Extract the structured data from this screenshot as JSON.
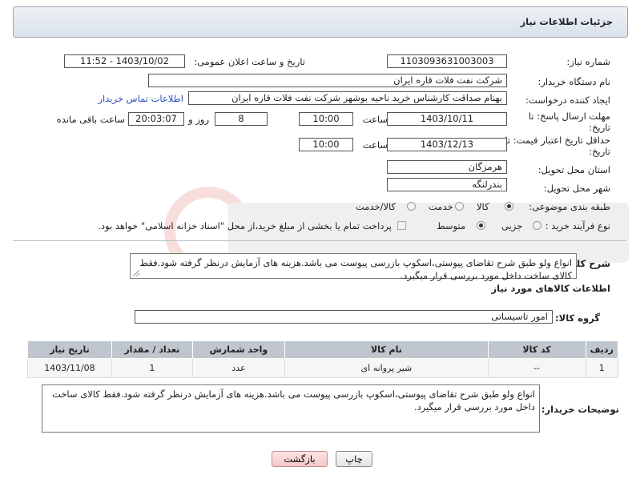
{
  "header": {
    "title": "جزئیات اطلاعات نیاز"
  },
  "form": {
    "need_number_label": "شماره نیاز:",
    "need_number": "1103093631003003",
    "announce_label": "تاریخ و ساعت اعلان عمومی:",
    "announce_value": "1403/10/02 - 11:52",
    "buyer_org_label": "نام دستگاه خریدار:",
    "buyer_org": "شرکت نفت فلات قاره ایران",
    "creator_label": "ایجاد کننده درخواست:",
    "creator": "بهنام  صداقت کارشناس خرید ناحیه بوشهر شرکت نفت فلات قاره ایران",
    "contact_link": "اطلاعات تماس خریدار",
    "reply_deadline_label": "مهلت ارسال پاسخ: تا",
    "reply_deadline_label2": "تاریخ:",
    "reply_date": "1403/10/11",
    "time_label": "ساعت",
    "reply_time": "10:00",
    "days_value": "8",
    "days_label": "روز و",
    "remaining_time": "20:03:07",
    "remaining_label": "ساعت باقی مانده",
    "price_validity_label": "حداقل تاریخ اعتبار قیمت: تا",
    "price_validity_label2": "تاریخ:",
    "price_date": "1403/12/13",
    "price_time": "10:00",
    "province_label": "استان محل تحویل:",
    "province": "هرمزگان",
    "city_label": "شهر محل تحویل:",
    "city": "بندرلنگه",
    "category_label": "طبقه بندی موضوعی:",
    "category_options": [
      "کالا",
      "خدمت",
      "کالا/خدمت"
    ],
    "process_label": "نوع فرآیند خرید :",
    "process_options": [
      "جزیی",
      "متوسط"
    ],
    "payment_text": "پرداخت تمام یا بخشی از مبلغ خرید،از محل \"اسناد خزانه اسلامی\" خواهد بود."
  },
  "description": {
    "label": "شرح کلی نیاز:",
    "text": "انواع ولو طبق شرح تقاضای پیوستی،اسکوپ بازرسی پیوست می باشد.هزینه های آزمایش درنظر گرفته شود.فقط کالای ساخت داخل مورد بررسی قرار میگیرد."
  },
  "goods": {
    "section_title": "اطلاعات کالاهای مورد نیاز",
    "group_label": "گروه کالا:",
    "group_value": "امور تاسیساتی",
    "columns": [
      "ردیف",
      "کد کالا",
      "نام کالا",
      "واحد شمارش",
      "تعداد / مقدار",
      "تاریخ نیاز"
    ],
    "rows": [
      [
        "1",
        "--",
        "شیر پروانه ای",
        "عدد",
        "1",
        "1403/11/08"
      ]
    ]
  },
  "buyer_notes": {
    "label": "توضیحات خریدار:",
    "text": "انواع ولو طبق شرح تقاضای پیوستی،اسکوپ بازرسی پیوست می باشد.هزینه های آزمایش درنظر گرفته شود.فقط کالای ساخت داخل مورد بررسی قرار میگیرد."
  },
  "buttons": {
    "print": "چاپ",
    "back": "بازگشت"
  },
  "colors": {
    "header_bg": "#dfe6ed",
    "table_header_bg": "#bfc6cd",
    "link": "#2a4fbf",
    "back_button": "#f4c8c8"
  }
}
